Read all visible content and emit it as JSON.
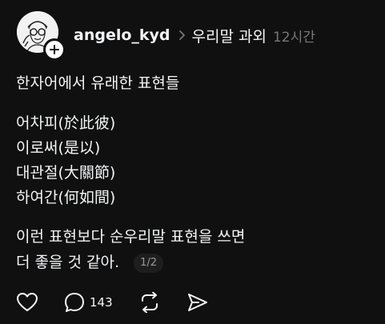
{
  "header": {
    "username": "angelo_kyd",
    "topic": "우리말 과외",
    "time": "12시간"
  },
  "post": {
    "intro": "한자어에서 유래한 표현들",
    "list": [
      "어차피(於此彼)",
      "이로써(是以)",
      "대관절(大關節)",
      "하여간(何如間)"
    ],
    "closing_line1": "이런 표현보다 순우리말 표현을 쓰면",
    "closing_line2": "더 좋을 것 같아.",
    "page_indicator": "1/2"
  },
  "actions": {
    "reply_count": "143"
  },
  "icons": [
    "person-sketch-avatar",
    "plus-icon",
    "chevron-right-icon",
    "heart-icon",
    "comment-icon",
    "repost-icon",
    "share-icon"
  ]
}
